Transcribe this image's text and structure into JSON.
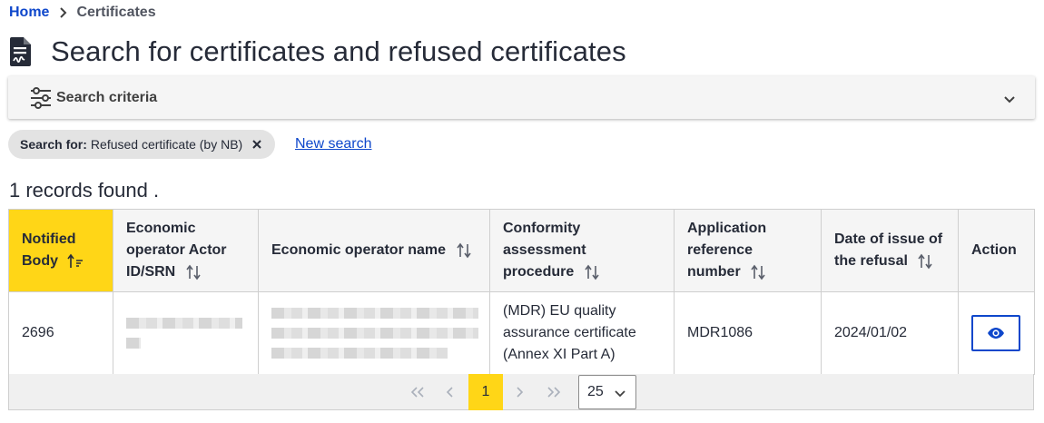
{
  "breadcrumb": {
    "home": "Home",
    "current": "Certificates"
  },
  "page": {
    "title": "Search for certificates and refused certificates"
  },
  "search_panel": {
    "label": "Search criteria"
  },
  "filter_chip": {
    "prefix": "Search for:",
    "value": "Refused certificate (by NB)"
  },
  "new_search": "New search",
  "results": {
    "count_text": "1 records found ."
  },
  "table": {
    "columns": [
      "Notified Body",
      "Economic operator Actor ID/SRN",
      "Economic operator name",
      "Conformity assessment procedure",
      "Application reference number",
      "Date of issue of the refusal",
      "Action"
    ],
    "rows": [
      {
        "notified_body": "2696",
        "actor_id": "",
        "operator_name": "",
        "procedure": "(MDR) EU quality assurance certificate (Annex XI Part A)",
        "reference": "MDR1086",
        "date": "2024/01/02"
      }
    ]
  },
  "pagination": {
    "current_page": "1",
    "page_size": "25"
  },
  "colors": {
    "accent": "#ffd617",
    "link": "#0e47cb",
    "text": "#262b38"
  },
  "icons": [
    "chevron-right-icon",
    "certificate-file-icon",
    "sliders-icon",
    "chevron-down-icon",
    "close-icon",
    "sort-icon",
    "sort-ascending-icon",
    "eye-icon",
    "first-page-icon",
    "previous-page-icon",
    "next-page-icon",
    "last-page-icon"
  ]
}
